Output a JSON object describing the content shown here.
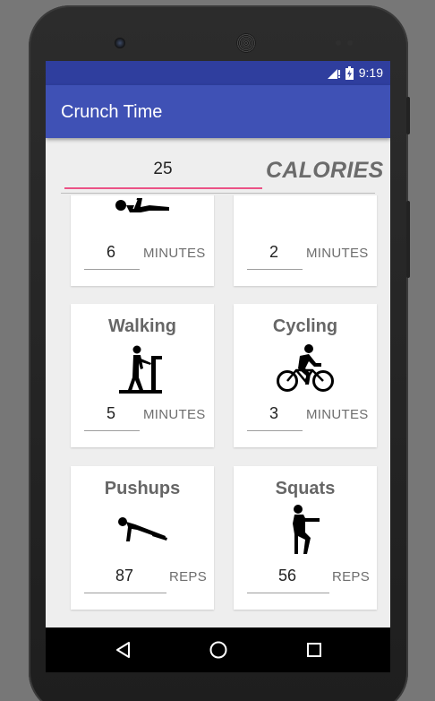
{
  "status_bar": {
    "time": "9:19"
  },
  "app_bar": {
    "title": "Crunch Time"
  },
  "calories": {
    "value": "25",
    "unit_label": "CALORIES"
  },
  "exercises": [
    {
      "name": "",
      "icon": "situps-icon",
      "value": "6",
      "unit": "MINUTES"
    },
    {
      "name": "",
      "icon": "standing-figure-icon",
      "value": "2",
      "unit": "MINUTES"
    },
    {
      "name": "Walking",
      "icon": "treadmill-walking-icon",
      "value": "5",
      "unit": "MINUTES"
    },
    {
      "name": "Cycling",
      "icon": "cycling-icon",
      "value": "3",
      "unit": "MINUTES"
    },
    {
      "name": "Pushups",
      "icon": "pushups-icon",
      "value": "87",
      "unit": "REPS"
    },
    {
      "name": "Squats",
      "icon": "squats-icon",
      "value": "56",
      "unit": "REPS"
    }
  ],
  "nav_bar": {
    "buttons": [
      "back-icon",
      "home-icon",
      "recents-icon"
    ]
  },
  "colors": {
    "status_bar": "#2f3e9e",
    "app_bar": "#3f51b5",
    "accent_underline": "#e91e63",
    "background": "#eeeeee"
  }
}
